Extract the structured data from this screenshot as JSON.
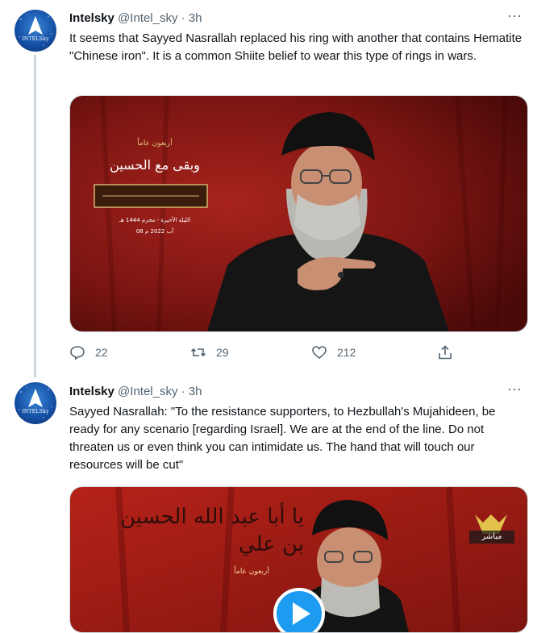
{
  "tweets": [
    {
      "avatar_text": "INTELSky",
      "author_name": "Intelsky",
      "author_handle": "@Intel_sky",
      "separator": "·",
      "time": "3h",
      "more_label": "···",
      "text": "It seems that Sayyed Nasrallah replaced his ring with another that contains Hematite \"Chinese iron\". It is a common Shiite belief to wear this type of rings in wars.",
      "media": {
        "background_color": "#7a1512",
        "banner_lines": [
          "وبقى مع الحسين",
          "الليلة الأخيرة - محرم 1444 هـ",
          "08 آب 2022 م"
        ],
        "banner_top_words": "أربعون عاماً"
      },
      "actions": {
        "reply_count": "22",
        "retweet_count": "29",
        "like_count": "212"
      }
    },
    {
      "avatar_text": "INTELSky",
      "author_name": "Intelsky",
      "author_handle": "@Intel_sky",
      "separator": "·",
      "time": "3h",
      "more_label": "···",
      "text": "Sayyed Nasrallah: \"To the resistance supporters, to Hezbullah's Mujahideen, be ready for any scenario [regarding Israel]. We are at the end of the line. Do not threaten us or even think you can intimidate us. The hand that will touch our resources will be cut\"",
      "media": {
        "background_color": "#a51d16",
        "calligraphy": "يا أبا عبد الله الحسين بن علي",
        "channel_label": "مباشر",
        "banner_top_words": "أربعون عاماً"
      }
    }
  ],
  "colors": {
    "text_primary": "#0f1419",
    "text_secondary": "#536471",
    "thread_line": "#cfd9de",
    "play_button": "#1d9bf0"
  }
}
